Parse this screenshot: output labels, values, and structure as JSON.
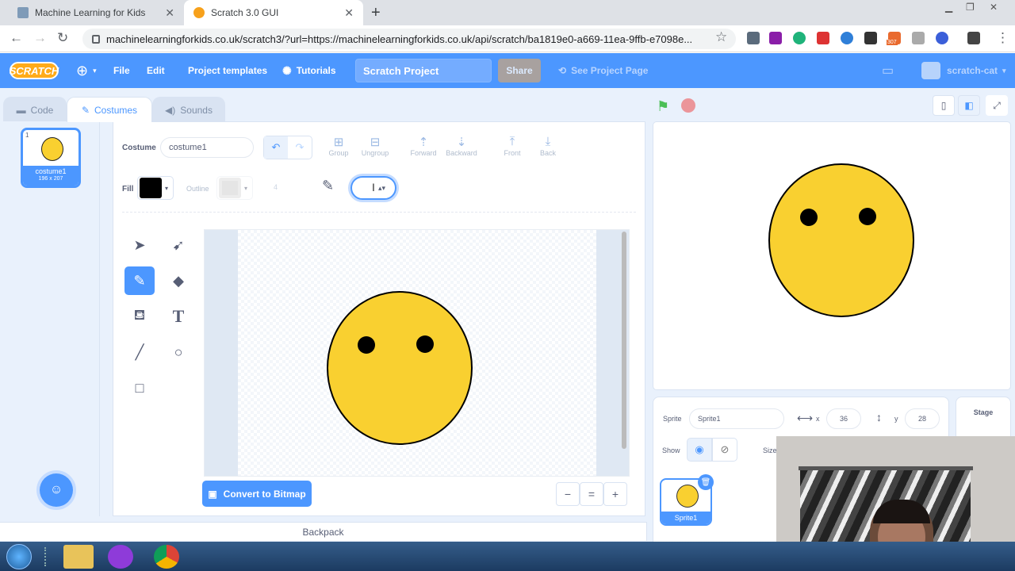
{
  "browser": {
    "tabs": [
      {
        "title": "Machine Learning for Kids",
        "favicon_color": "#7f9bb8"
      },
      {
        "title": "Scratch 3.0 GUI",
        "favicon_color": "#f7a11b",
        "active": true
      }
    ],
    "new_tab": "+",
    "url": "machinelearningforkids.co.uk/scratch3/?url=https://machinelearningforkids.co.uk/api/scratch/ba1819e0-a669-11ea-9ffb-e7098e...",
    "extension_badge": "307"
  },
  "menubar": {
    "logo": "SCRATCH",
    "file": "File",
    "edit": "Edit",
    "project_templates": "Project templates",
    "tutorials": "Tutorials",
    "project_title": "Scratch Project",
    "share": "Share",
    "see_project_page": "See Project Page",
    "username": "scratch-cat",
    "accent_color": "#4c97ff"
  },
  "editor_tabs": {
    "code": "Code",
    "costumes": "Costumes",
    "sounds": "Sounds",
    "active": "Costumes"
  },
  "costume_list": [
    {
      "number": "1",
      "name": "costume1",
      "size": "196 x 207"
    }
  ],
  "paint": {
    "costume_label": "Costume",
    "costume_name": "costume1",
    "group": "Group",
    "ungroup": "Ungroup",
    "forward": "Forward",
    "backward": "Backward",
    "front": "Front",
    "back": "Back",
    "fill_label": "Fill",
    "fill_color": "#000000",
    "outline_label": "Outline",
    "outline_width": "4",
    "active_tool": "brush",
    "convert_button": "Convert to Bitmap",
    "zoom_out": "−",
    "zoom_reset": "=",
    "zoom_in": "+"
  },
  "costume_drawing": {
    "face_color": "#f9d030",
    "stroke_color": "#000000",
    "eye_color": "#000000"
  },
  "backpack": "Backpack",
  "sprite_info": {
    "sprite_label": "Sprite",
    "sprite_name": "Sprite1",
    "x_label": "x",
    "x_value": "36",
    "y_label": "y",
    "y_value": "28",
    "show_label": "Show",
    "size_label": "Size"
  },
  "sprites": [
    {
      "name": "Sprite1"
    }
  ],
  "stage_label": "Stage"
}
